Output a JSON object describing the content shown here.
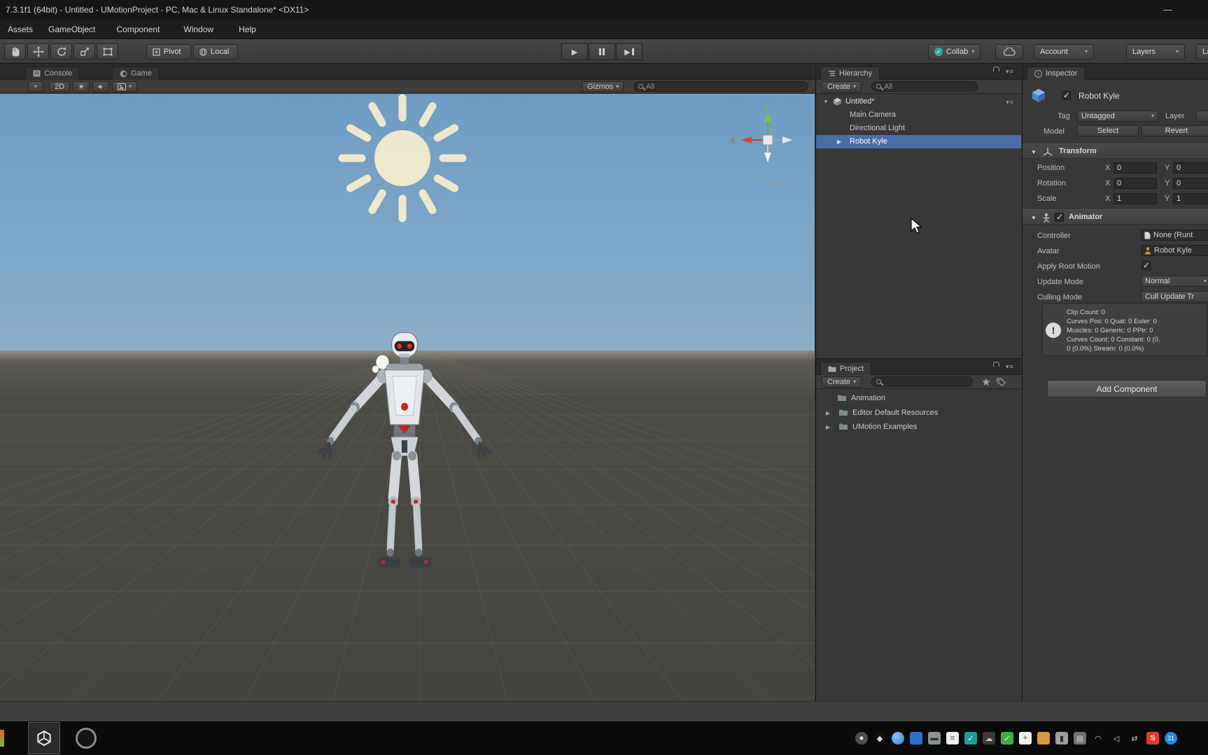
{
  "window": {
    "title": "7.3.1f1 (64bit) - Untitled - UMotionProject - PC, Mac & Linux Standalone* <DX11>"
  },
  "icons": {
    "chevron_down": "▾",
    "foldout_open": "▼",
    "foldout_closed": "▶",
    "menu": "≡",
    "minimize": "—",
    "play": "▶",
    "sun": "☀",
    "persp_arrow": "‹",
    "check": "✓"
  },
  "menu": {
    "items": [
      "Assets",
      "GameObject",
      "Component",
      "Window",
      "Help"
    ]
  },
  "toolbar": {
    "pivot": "Pivot",
    "local": "Local",
    "collab": "Collab",
    "account": "Account",
    "layers": "Layers",
    "layout": "Layout"
  },
  "scene": {
    "tabs": [
      "Console",
      "Game"
    ],
    "toolbar": {
      "mode2d": "2D",
      "gizmos": "Gizmos",
      "search_text": "All"
    },
    "axis_gizmo": {
      "x": "x",
      "y": "y",
      "persp": "Persp"
    }
  },
  "hierarchy": {
    "tab": "Hierarchy",
    "create": "Create",
    "search_text": "All",
    "scene_name": "Untitled*",
    "items": [
      "Main Camera",
      "Directional Light",
      "Robot Kyle"
    ]
  },
  "project": {
    "tab": "Project",
    "create": "Create",
    "search_text": "",
    "folders": [
      "Animation",
      "Editor Default Resources",
      "UMotion Examples"
    ]
  },
  "inspector": {
    "tab": "Inspector",
    "name": "Robot Kyle",
    "tag_label": "Tag",
    "tag_value": "Untagged",
    "layer_label": "Layer",
    "model_label": "Model",
    "select": "Select",
    "revert": "Revert",
    "transform": {
      "title": "Transform",
      "axis_x": "X",
      "axis_y": "Y",
      "rows": [
        {
          "label": "Position",
          "x": "0",
          "y": "0"
        },
        {
          "label": "Rotation",
          "x": "0",
          "y": "0"
        },
        {
          "label": "Scale",
          "x": "1",
          "y": "1"
        }
      ]
    },
    "animator": {
      "title": "Animator",
      "controller_label": "Controller",
      "controller_value": "None (Runt",
      "avatar_label": "Avatar",
      "avatar_value": "Robot Kyle",
      "root_motion_label": "Apply Root Motion",
      "update_mode_label": "Update Mode",
      "update_mode_value": "Normal",
      "culling_mode_label": "Culling Mode",
      "culling_mode_value": "Cull Update Tr",
      "info_lines": [
        "Clip Count: 0",
        "Curves Pos: 0 Quat: 0 Euler: 0",
        "Muscles: 0 Generic: 0 PPtr: 0",
        "Curves Count: 0 Constant: 0 (0.",
        "0 (0.0%) Stream: 0 (0.0%)"
      ]
    },
    "add_component": "Add Component"
  },
  "taskbar": {
    "badge": "31",
    "tray_icon_names": [
      "user",
      "notifier",
      "browser",
      "app-window",
      "display",
      "notes",
      "security-shield",
      "cloud",
      "antivirus-check",
      "updater-plus",
      "gallery-folder",
      "battery",
      "ethernet",
      "wifi",
      "volume",
      "layout-switch",
      "sogou-input",
      "date-badge"
    ]
  },
  "colors": {
    "selection": "#4a6da8",
    "sky_top": "#6e9cc3",
    "ground": "#4b4a45",
    "sun": "#f3ebcd"
  }
}
